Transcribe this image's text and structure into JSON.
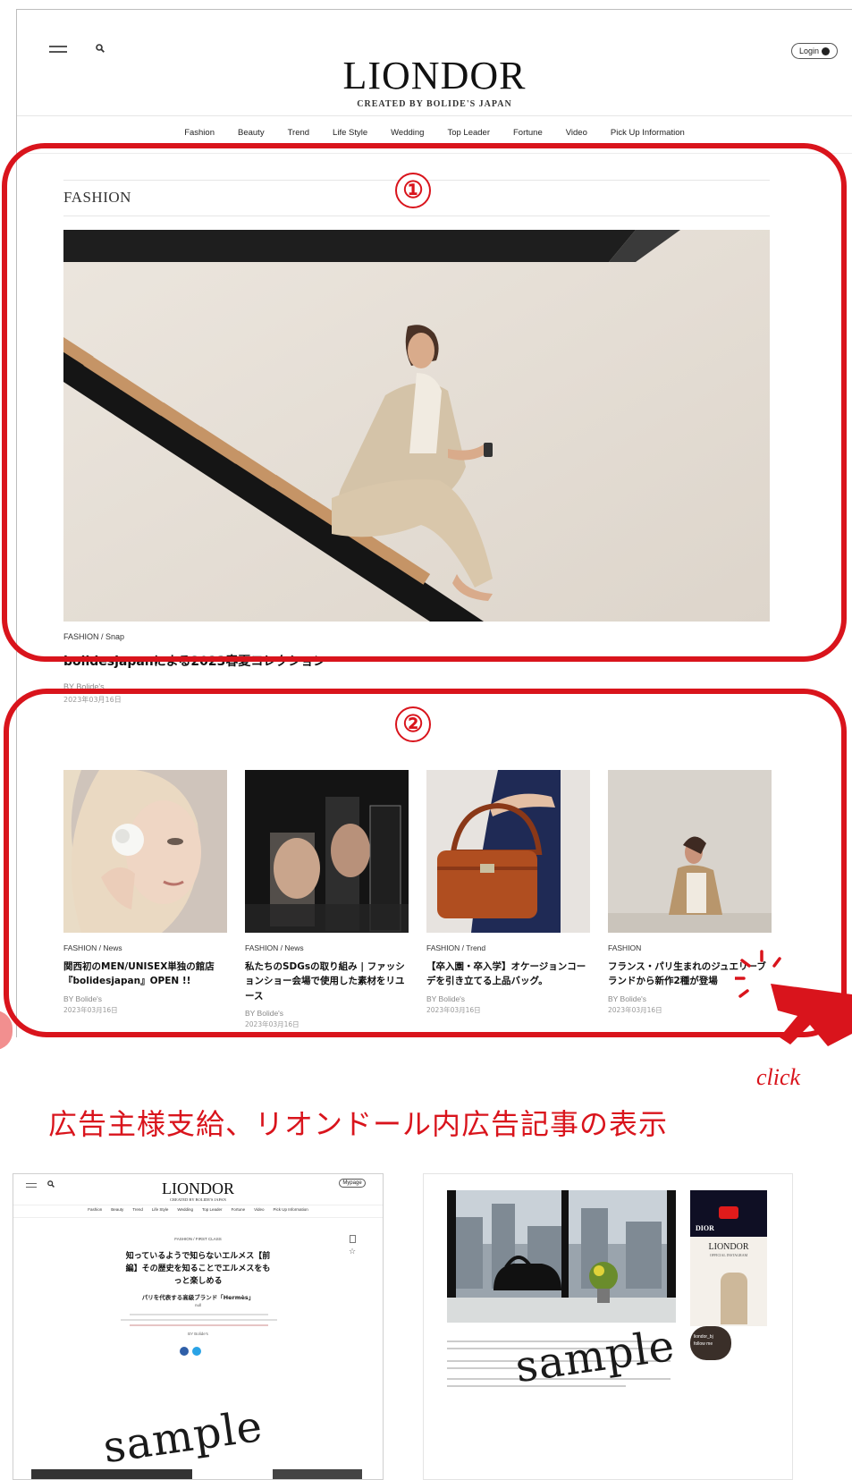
{
  "header": {
    "logo": "LIONDOR",
    "logo_sub": "CREATED BY BOLIDE'S JAPAN",
    "login_label": "Login"
  },
  "nav": [
    "Fashion",
    "Beauty",
    "Trend",
    "Life Style",
    "Wedding",
    "Top Leader",
    "Fortune",
    "Video",
    "Pick Up Information"
  ],
  "section": {
    "title": "FASHION"
  },
  "hero": {
    "category": "FASHION / Snap",
    "title": "bolidesjapanによる2023春夏コレクション",
    "by": "BY  Bolide's",
    "date": "2023年03月16日"
  },
  "cards": [
    {
      "category": "FASHION / News",
      "title": "関西初のMEN/UNISEX単独の館店『bolidesjapan』OPEN !!",
      "by": "BY  Bolide's",
      "date": "2023年03月16日"
    },
    {
      "category": "FASHION / News",
      "title": "私たちのSDGsの取り組み | ファッションショー会場で使用した素材をリユース",
      "by": "BY  Bolide's",
      "date": "2023年03月16日"
    },
    {
      "category": "FASHION / Trend",
      "title": "【卒入園・卒入学】オケージョンコーデを引き立てる上品バッグ。",
      "by": "BY  Bolide's",
      "date": "2023年03月16日"
    },
    {
      "category": "FASHION",
      "title": "フランス・パリ生まれのジュエリーブランドから新作2種が登場",
      "by": "BY  Bolide's",
      "date": "2023年03月16日"
    }
  ],
  "annotations": {
    "marker_1": "①",
    "marker_2": "②",
    "click": "click",
    "caption": "広告主様支給、リオンドール内広告記事の表示",
    "accent_color": "#d9141c"
  },
  "sample_left": {
    "logo": "LIONDOR",
    "logo_sub": "CREATED BY BOLIDE'S JAPAN",
    "mypage_label": "Mypage",
    "nav": [
      "Fashion",
      "Beauty",
      "Trend",
      "Life Style",
      "Wedding",
      "Top Leader",
      "Fortune",
      "Video",
      "Pick Up Information"
    ],
    "category": "FASHION / FIRST CLASS",
    "title_line1": "知っているようで知らないエルメス【前",
    "title_line2": "編】その歴史を知ることでエルメスをも",
    "title_line3": "っと楽しめる",
    "subtitle": "パリを代表する高級ブランド「Hermès」",
    "null_text": "null",
    "by": "BY  Bolide's",
    "watermark": "sample"
  },
  "sample_right": {
    "promo_brand": "DIOR",
    "promo_logo": "LIONDOR",
    "promo_sub": "OFFICIAL INSTAGRAM",
    "follow_handle": "liondor_bj",
    "follow_label": "follow me",
    "watermark": "sample"
  }
}
